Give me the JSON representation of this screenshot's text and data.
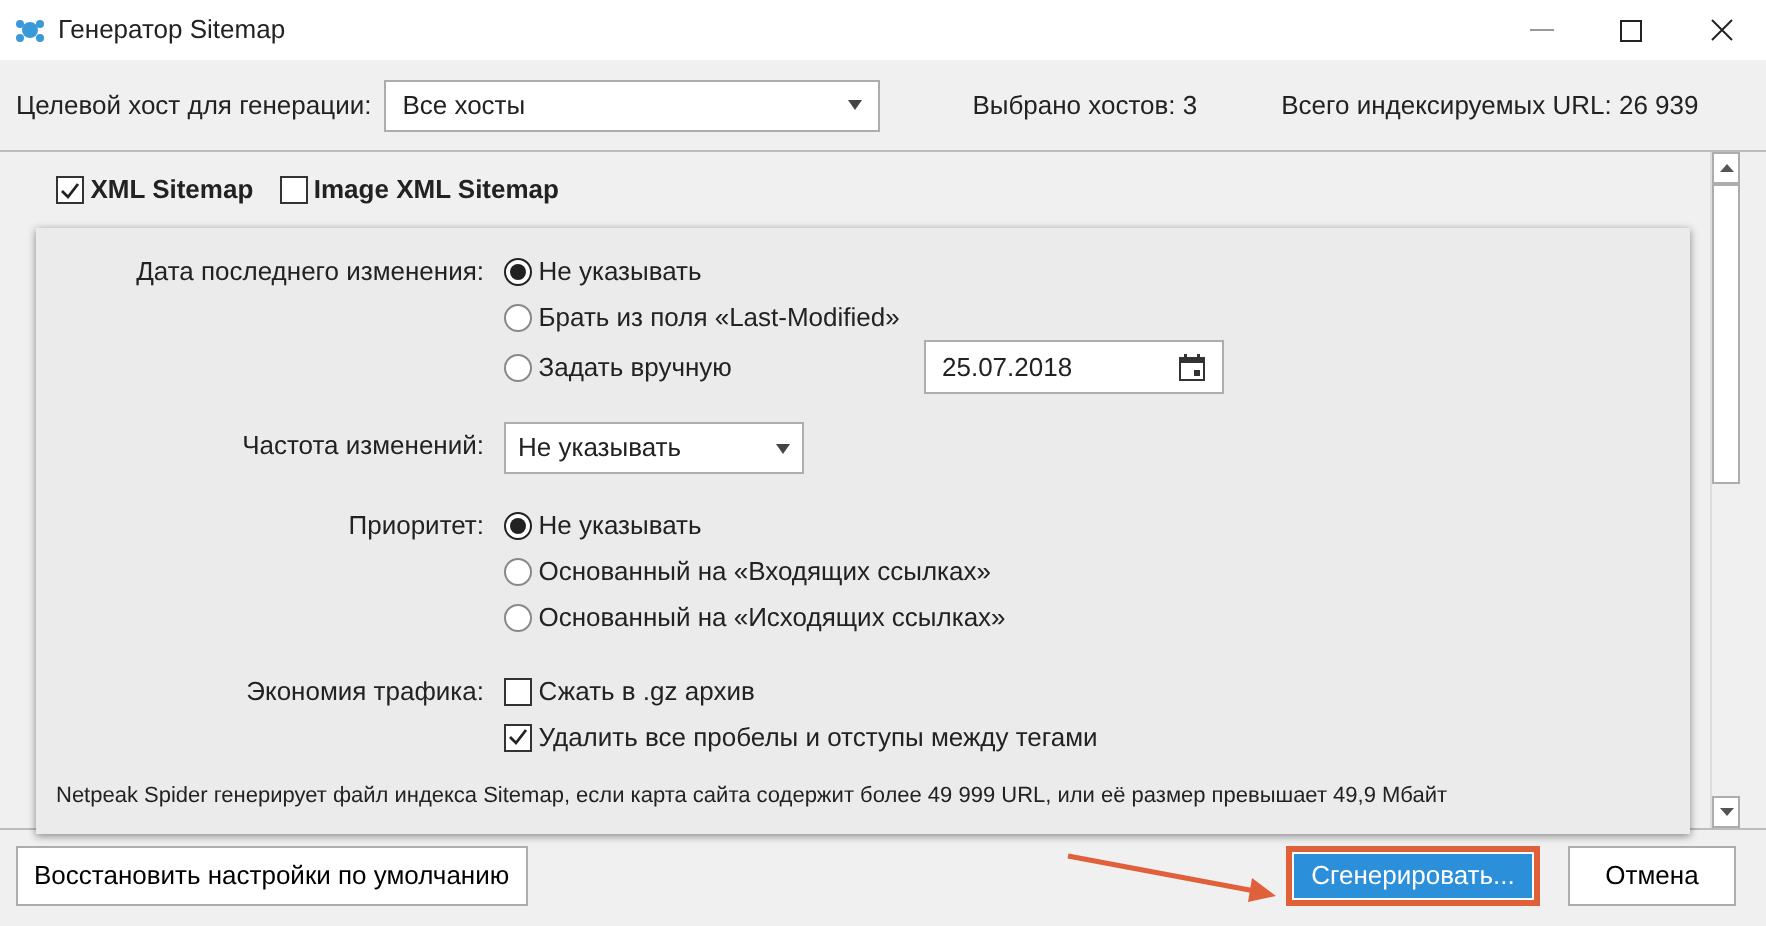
{
  "window": {
    "title": "Генератор Sitemap"
  },
  "host": {
    "label": "Целевой хост для генерации:",
    "value": "Все хосты"
  },
  "stats": [
    "Выбрано хостов: 3",
    "Всего индексируемых URL: 26 939"
  ],
  "sitemap_types": [
    {
      "label": "XML Sitemap",
      "checked": true
    },
    {
      "label": "Image XML Sitemap",
      "checked": false
    }
  ],
  "settings": [
    {
      "label": "Дата последнего изменения:",
      "kind": "radio",
      "options": [
        {
          "label": "Не указывать",
          "selected": true
        },
        {
          "label": "Брать из поля «Last-Modified»",
          "selected": false
        },
        {
          "label": "Задать вручную",
          "selected": false,
          "date": "25.07.2018"
        }
      ]
    },
    {
      "label": "Частота изменений:",
      "kind": "select",
      "value": "Не указывать"
    },
    {
      "label": "Приоритет:",
      "kind": "radio",
      "options": [
        {
          "label": "Не указывать",
          "selected": true
        },
        {
          "label": "Основанный на «Входящих ссылках»",
          "selected": false
        },
        {
          "label": "Основанный на «Исходящих ссылках»",
          "selected": false
        }
      ]
    },
    {
      "label": "Экономия трафика:",
      "kind": "checkbox",
      "options": [
        {
          "label": "Сжать в .gz архив",
          "checked": false
        },
        {
          "label": "Удалить все пробелы и отступы между тегами",
          "checked": true
        }
      ]
    }
  ],
  "note": "Netpeak Spider генерирует файл индекса Sitemap, если карта сайта содержит более 49 999 URL, или её размер превышает 49,9 Мбайт",
  "buttons": [
    {
      "label": "Восстановить настройки по умолчанию",
      "kind": "default",
      "highlighted": false
    },
    {
      "label": "Сгенерировать...",
      "kind": "primary",
      "highlighted": true
    },
    {
      "label": "Отмена",
      "kind": "default",
      "highlighted": false
    }
  ]
}
